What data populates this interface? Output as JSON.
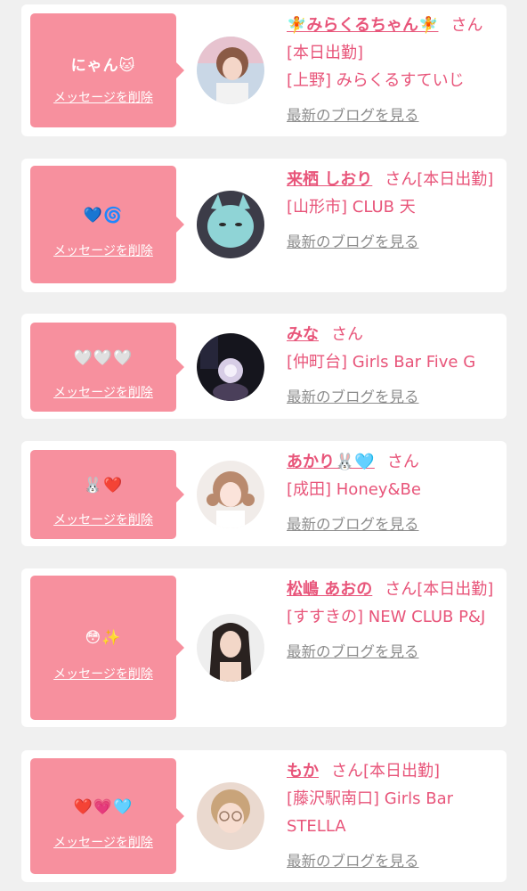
{
  "messages": [
    {
      "bubble": "にゃん🐱",
      "delete_label": "メッセージを削除",
      "name": "🧚みらくるちゃん🧚",
      "san": "さん",
      "status": "[本日出勤]",
      "shop": "[上野] みらくるすていじ",
      "blog_label": "最新のブログを見る"
    },
    {
      "bubble": "💙🌀",
      "delete_label": "メッセージを削除",
      "name": "来栖 しおり",
      "san": "さん",
      "status": "[本日出勤]",
      "shop": "[山形市] CLUB 天",
      "blog_label": "最新のブログを見る"
    },
    {
      "bubble": "🤍🤍🤍",
      "delete_label": "メッセージを削除",
      "name": "みな",
      "san": "さん",
      "status": "",
      "shop": "[仲町台] Girls Bar Five G",
      "blog_label": "最新のブログを見る"
    },
    {
      "bubble": "🐰❤️",
      "delete_label": "メッセージを削除",
      "name": "あかり🐰🩵",
      "san": "さん",
      "status": "",
      "shop": "[成田] Honey&Be",
      "blog_label": "最新のブログを見る"
    },
    {
      "bubble": "😳✨",
      "delete_label": "メッセージを削除",
      "name": "松嶋 あおの",
      "san": "さん",
      "status": "[本日出勤]",
      "shop": "[すすきの] NEW CLUB P&J",
      "blog_label": "最新のブログを見る"
    },
    {
      "bubble": "❤️💗🩵",
      "delete_label": "メッセージを削除",
      "name": "もか",
      "san": "さん",
      "status": "[本日出勤]",
      "shop": "[藤沢駅南口] Girls Bar STELLA",
      "blog_label": "最新のブログを見る"
    }
  ]
}
